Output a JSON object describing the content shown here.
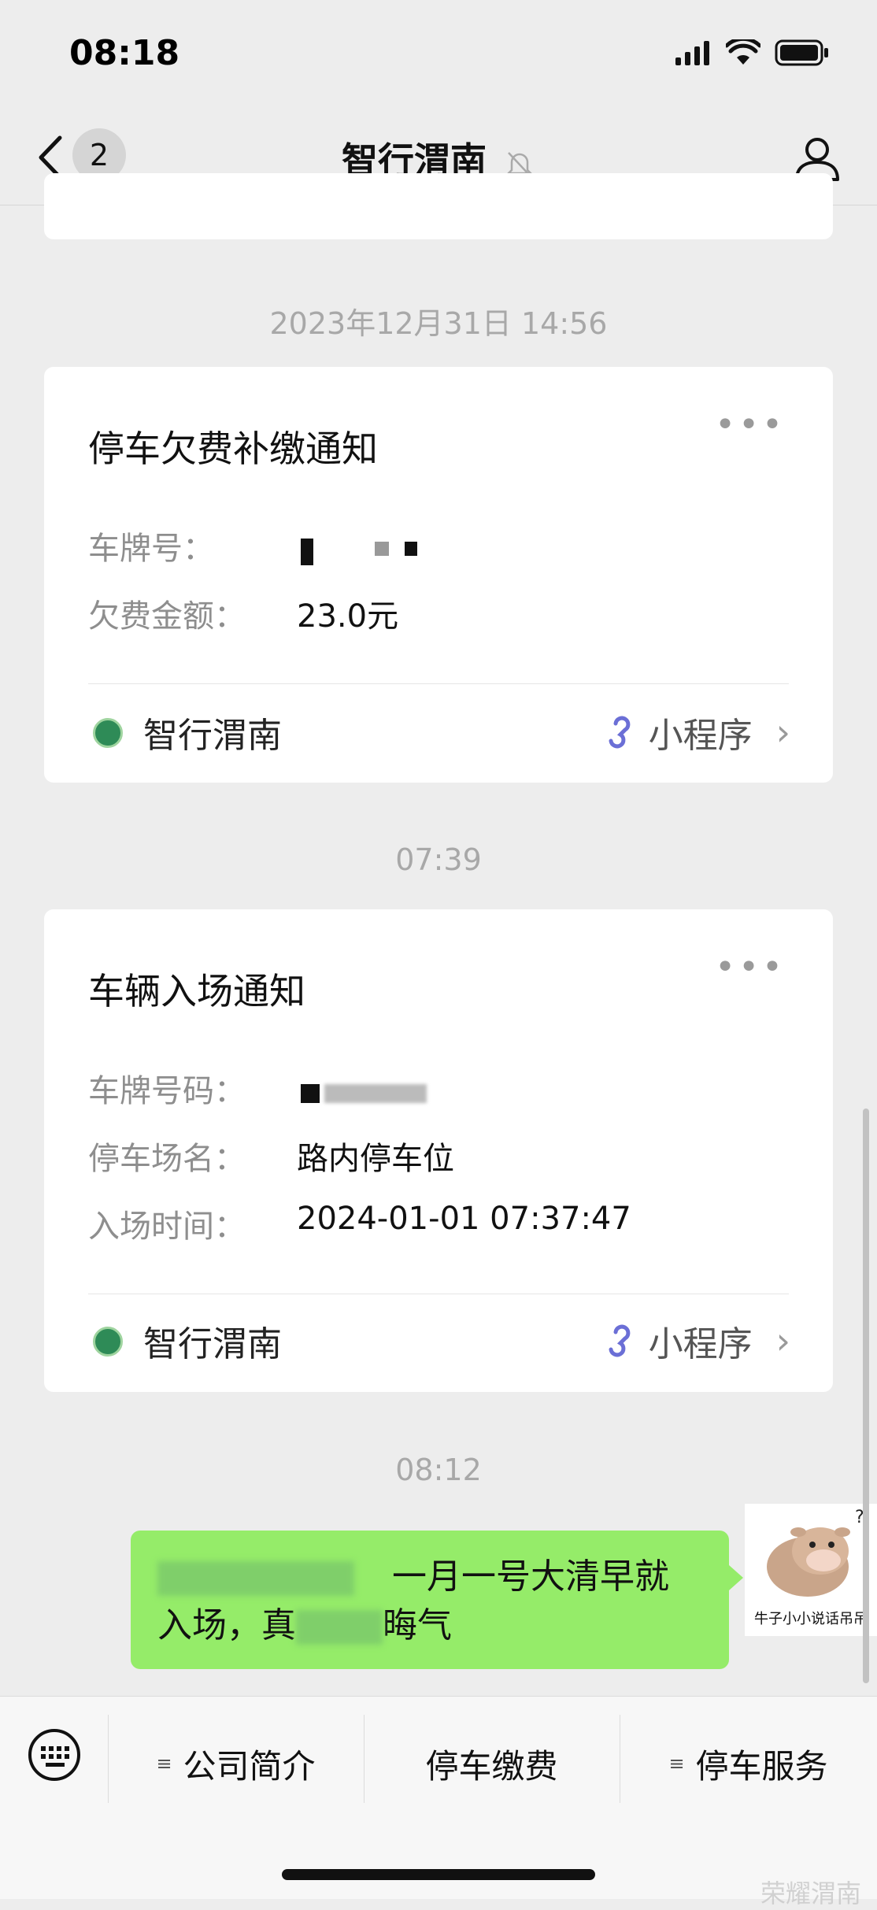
{
  "status_bar": {
    "time": "08:18"
  },
  "nav": {
    "unread_count": "2",
    "title": "智行渭南"
  },
  "timestamps": {
    "first": "2023年12月31日 14:56",
    "second": "07:39",
    "third": "08:12"
  },
  "card1": {
    "title": "停车欠费补缴通知",
    "fields": [
      {
        "label": "车牌号：",
        "value": ""
      },
      {
        "label": "欠费金额：",
        "value": "23.0元"
      }
    ],
    "brand": "智行渭南",
    "mini_program": "小程序"
  },
  "card2": {
    "title": "车辆入场通知",
    "fields": [
      {
        "label": "车牌号码：",
        "value": ""
      },
      {
        "label": "停车场名：",
        "value": "路内停车位"
      },
      {
        "label": "入场时间：",
        "value": "2024-01-01 07:37:47"
      }
    ],
    "brand": "智行渭南",
    "mini_program": "小程序"
  },
  "message": {
    "line1_visible": "一月一号大清早就",
    "line2_part1": "入场，真",
    "line2_part2": "晦气"
  },
  "avatar": {
    "caption": "牛子小小说话吊吊"
  },
  "menu": {
    "items": [
      "公司简介",
      "停车缴费",
      "停车服务"
    ]
  },
  "watermark": "荣耀渭南",
  "colors": {
    "bubble": "#95ec69",
    "mini_program_icon": "#6b6fd6",
    "background": "#ededed"
  }
}
